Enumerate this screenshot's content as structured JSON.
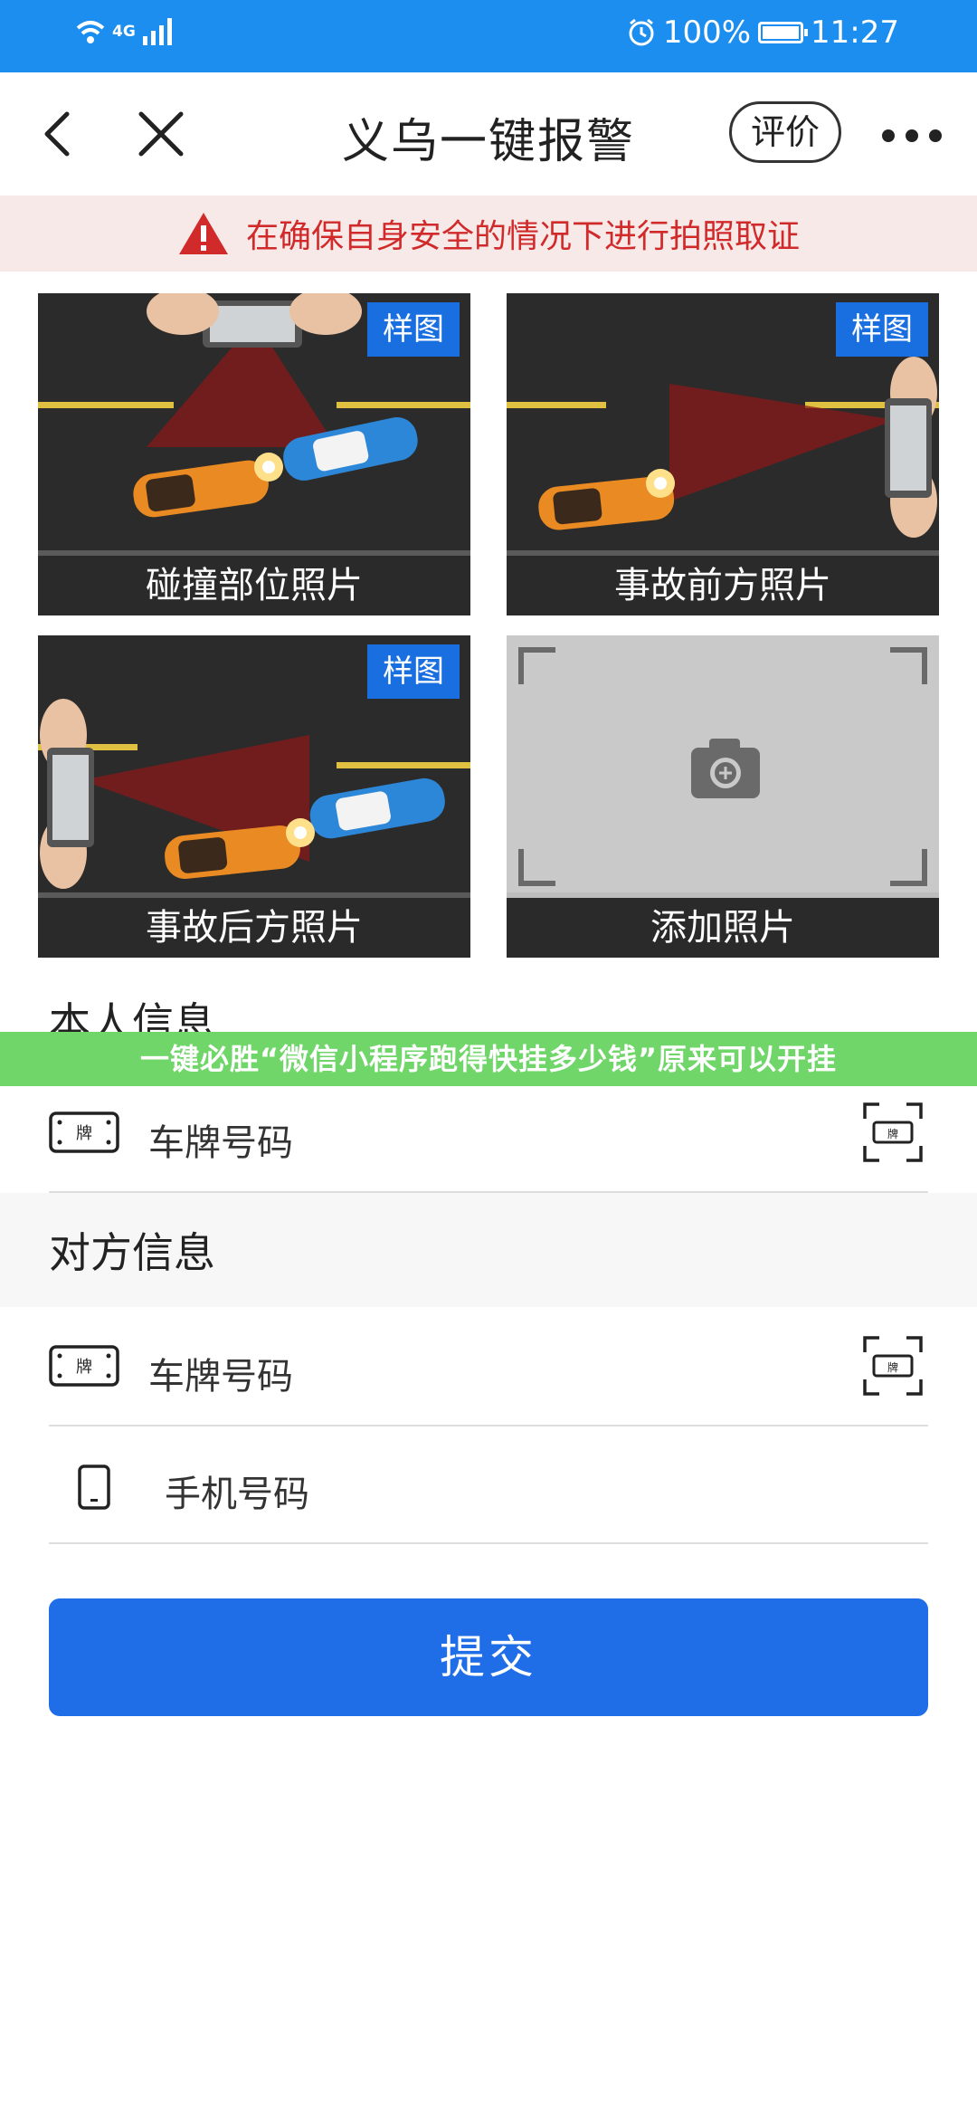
{
  "status_bar": {
    "network": "4G",
    "battery": "100%",
    "battery_fraction": 1.0,
    "time": "11:27",
    "icons": [
      "wifi-icon",
      "signal-icon",
      "alarm-icon",
      "battery-icon"
    ]
  },
  "nav": {
    "title": "义乌一键报警",
    "rate_label": "评价",
    "icons": [
      "back-icon",
      "close-icon",
      "more-icon"
    ]
  },
  "warning": {
    "text": "在确保自身安全的情况下进行拍照取证",
    "color": "#d12a2a",
    "icon": "warning-icon"
  },
  "photos": [
    {
      "caption": "碰撞部位照片",
      "badge": "样图"
    },
    {
      "caption": "事故前方照片",
      "badge": "样图"
    },
    {
      "caption": "事故后方照片",
      "badge": "样图"
    },
    {
      "caption": "添加照片",
      "icon": "camera-add-icon"
    }
  ],
  "self_info": {
    "title": "本人信息",
    "plate_label": "车牌号码"
  },
  "watermark": {
    "text": "一键必胜“微信小程序跑得快挂多少钱”原来可以开挂"
  },
  "other_info": {
    "title": "对方信息",
    "plate_label": "车牌号码",
    "phone_label": "手机号码"
  },
  "plate_icon_text": "牌",
  "submit_label": "提交",
  "colors": {
    "status_bar": "#1b8ef0",
    "accent": "#1f6ee8",
    "badge": "#1a6fe0",
    "warning_bg": "#f8e9e9",
    "watermark_bg": "#71d66a"
  }
}
